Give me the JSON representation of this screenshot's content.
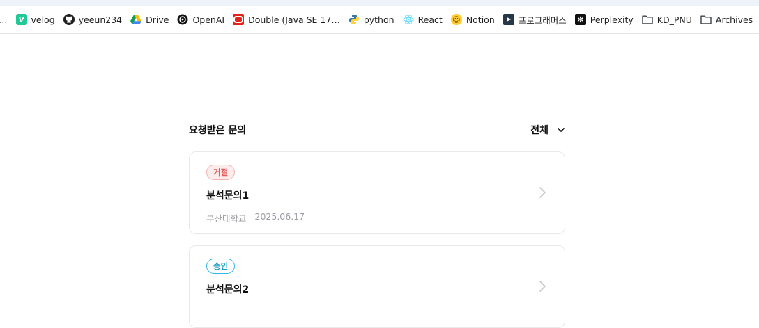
{
  "bookmarks": [
    {
      "label": "…",
      "icon": "truncated-bookmark"
    },
    {
      "label": "velog",
      "icon": "velog-icon"
    },
    {
      "label": "yeeun234",
      "icon": "github-icon"
    },
    {
      "label": "Drive",
      "icon": "google-drive-icon"
    },
    {
      "label": "OpenAI",
      "icon": "openai-icon"
    },
    {
      "label": "Double (Java SE 17…",
      "icon": "oracle-icon"
    },
    {
      "label": "python",
      "icon": "python-icon"
    },
    {
      "label": "React",
      "icon": "react-icon"
    },
    {
      "label": "Notion",
      "icon": "smiley-icon"
    },
    {
      "label": "프로그래머스",
      "icon": "programmers-icon"
    },
    {
      "label": "Perplexity",
      "icon": "perplexity-icon"
    },
    {
      "label": "KD_PNU",
      "icon": "folder-icon"
    },
    {
      "label": "Archives",
      "icon": "folder-icon"
    }
  ],
  "header": {
    "title": "요청받은 문의",
    "filter_label": "전체"
  },
  "inquiries": [
    {
      "status": "거절",
      "status_color": "#e25c5c",
      "title": "분석문의1",
      "organization": "부산대학교",
      "date": "2025.06.17"
    },
    {
      "status": "승인",
      "status_color": "#1a9dc9",
      "title": "분석문의2"
    }
  ]
}
